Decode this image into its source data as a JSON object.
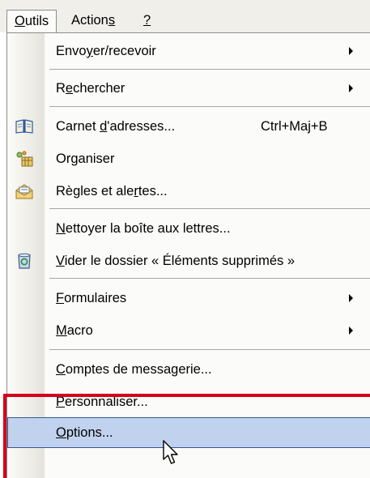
{
  "menubar": {
    "items": [
      {
        "label": "Outils",
        "active": true
      },
      {
        "label": "Actions"
      },
      {
        "label": "?"
      }
    ]
  },
  "menu": {
    "items": [
      {
        "label": "Envoyer/recevoir",
        "submenu": true
      },
      {
        "label": "Rechercher",
        "submenu": true
      },
      {
        "label": "Carnet d'adresses...",
        "shortcut": "Ctrl+Maj+B",
        "icon": "address-book-icon"
      },
      {
        "label": "Organiser",
        "icon": "organize-icon"
      },
      {
        "label": "Règles et alertes...",
        "icon": "rules-alerts-icon"
      },
      {
        "label": "Nettoyer la boîte aux lettres..."
      },
      {
        "label": "Vider le dossier « Éléments supprimés »",
        "icon": "recycle-bin-icon"
      },
      {
        "label": "Formulaires",
        "submenu": true
      },
      {
        "label": "Macro",
        "submenu": true
      },
      {
        "label": "Comptes de messagerie..."
      },
      {
        "label": "Personnaliser..."
      },
      {
        "label": "Options...",
        "highlighted": true
      }
    ]
  },
  "colors": {
    "highlight_fill": "#c1d2ee",
    "highlight_border": "#33598e",
    "annotation_red": "#d4001d"
  }
}
